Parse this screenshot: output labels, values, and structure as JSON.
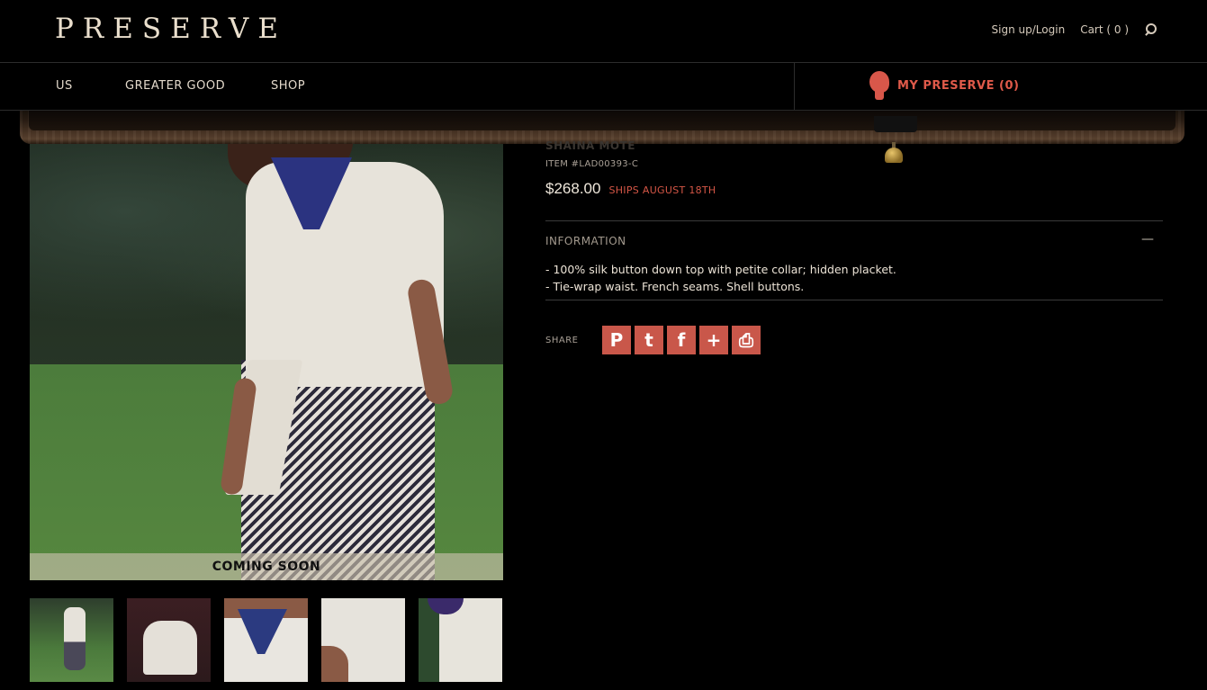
{
  "header": {
    "logo": "PRESERVE",
    "signup_login": "Sign up/Login",
    "cart": "Cart ( 0 )",
    "search_icon": "search-icon"
  },
  "nav": {
    "items": [
      "US",
      "GREATER GOOD",
      "SHOP"
    ],
    "my_preserve": "MY PRESERVE (0)"
  },
  "product": {
    "designer": "SHAINA MOTE",
    "item_number": "ITEM #LAD00393-C",
    "price": "$268.00",
    "ships": "SHIPS AUGUST 18TH",
    "badge": "COMING SOON",
    "information_heading": "INFORMATION",
    "information_toggle": "—",
    "information_lines": [
      "- 100% silk button down top with petite collar; hidden placket.",
      "- Tie-wrap waist. French seams. Shell buttons."
    ]
  },
  "share": {
    "label": "SHARE",
    "buttons": [
      {
        "name": "pinterest-icon",
        "glyph": "P"
      },
      {
        "name": "twitter-icon",
        "glyph": "t"
      },
      {
        "name": "facebook-icon",
        "glyph": "f"
      },
      {
        "name": "plus-icon",
        "glyph": "+"
      },
      {
        "name": "print-icon",
        "glyph": "⎙"
      }
    ]
  },
  "thumbnails": 5,
  "colors": {
    "accent": "#d45646",
    "background": "#000000",
    "share_button": "#c9574a"
  }
}
